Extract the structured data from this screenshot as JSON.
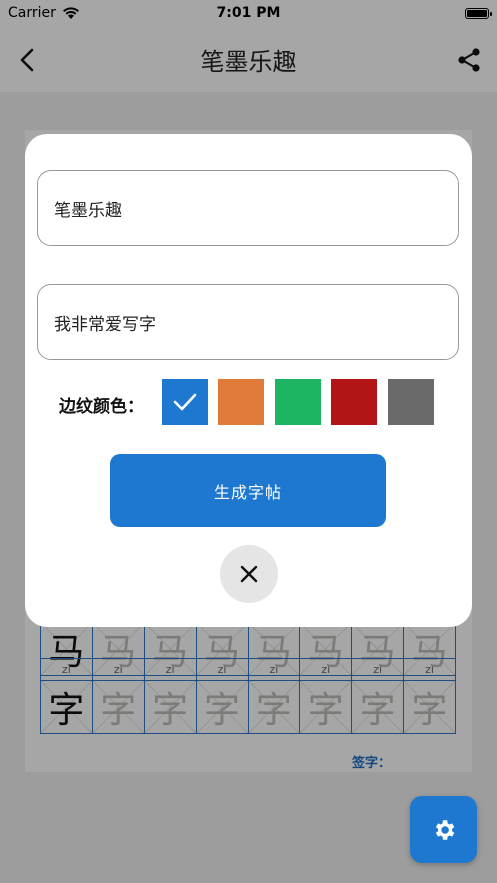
{
  "status_bar": {
    "carrier": "Carrier",
    "time": "7:01 PM"
  },
  "nav": {
    "title": "笔墨乐趣"
  },
  "worksheet": {
    "rows": [
      {
        "pinyin": "",
        "char": "马",
        "cells": [
          "马",
          "马",
          "马",
          "马",
          "马",
          "马",
          "马",
          "马"
        ]
      },
      {
        "pinyin": "zì",
        "char": "字",
        "cells": [
          "字",
          "字",
          "字",
          "字",
          "字",
          "字",
          "字",
          "字"
        ]
      }
    ],
    "sign_label": "签字："
  },
  "dialog": {
    "title_input": {
      "value": "笔墨乐趣"
    },
    "content_input": {
      "value": "我非常爱写字"
    },
    "color_label": "边纹颜色：",
    "colors": [
      {
        "name": "blue",
        "hex": "#1e78d0",
        "selected": true
      },
      {
        "name": "orange",
        "hex": "#e07b39",
        "selected": false
      },
      {
        "name": "green",
        "hex": "#1db462",
        "selected": false
      },
      {
        "name": "red",
        "hex": "#b31416",
        "selected": false
      },
      {
        "name": "gray",
        "hex": "#6a6a6a",
        "selected": false
      }
    ],
    "generate_button": "生成字帖",
    "close_icon": "close-icon"
  },
  "fab": {
    "icon": "gear-icon"
  }
}
